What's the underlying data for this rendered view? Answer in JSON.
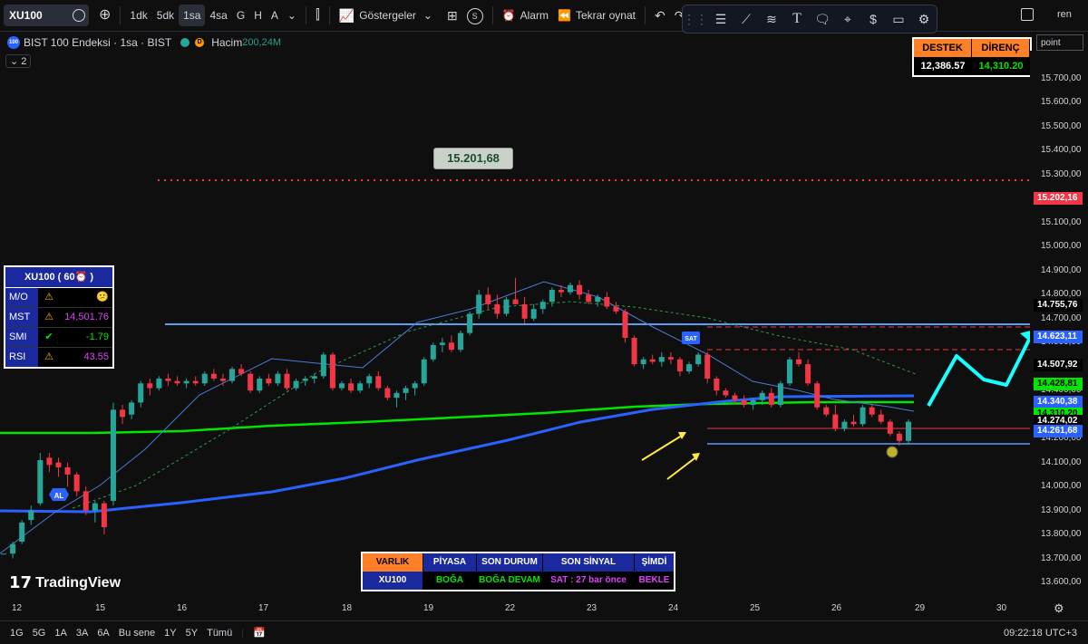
{
  "topbar": {
    "symbol": "XU100",
    "intervals": [
      "1dk",
      "5dk",
      "1sa",
      "4sa",
      "G",
      "H",
      "A"
    ],
    "active_interval": "1sa",
    "indicators_label": "Göstergeler",
    "alarm_label": "Alarm",
    "replay_label": "Tekrar oynat",
    "badge": "S",
    "user": "ren"
  },
  "legend": {
    "title": "BIST 100 Endeksi · 1sa · BIST",
    "badge_d": "D",
    "volume_label": "Hacim",
    "volume_value": "200,24M",
    "collapse": "2"
  },
  "support_resistance": {
    "support_label": "DESTEK",
    "resistance_label": "DİRENÇ",
    "support_value": "12,386.57",
    "resistance_value": "14,310.20"
  },
  "point_label": "point",
  "annotation": "15.201,68",
  "price_scale": {
    "labels": [
      "15.700,00",
      "15.600,00",
      "15.500,00",
      "15.400,00",
      "15.300,00",
      "15.200,00",
      "15.100,00",
      "15.000,00",
      "14.900,00",
      "14.800,00",
      "14.700,00",
      "14.600,00",
      "14.500,00",
      "14.400,00",
      "14.300,00",
      "14.200,00",
      "14.100,00",
      "14.000,00",
      "13.900,00",
      "13.800,00",
      "13.700,00",
      "13.600,00"
    ],
    "tags": [
      {
        "text": "15.202,16",
        "color": "#f23645",
        "bg": "#f23645",
        "fg": "#fff"
      },
      {
        "text": "14.755,76",
        "bg": "#000",
        "fg": "#fff"
      },
      {
        "text": "14.623,11",
        "bg": "#2962ff",
        "fg": "#fff"
      },
      {
        "text": "14.507,92",
        "bg": "#000",
        "fg": "#fff"
      },
      {
        "text": "14.428,81",
        "bg": "#00e600",
        "fg": "#000"
      },
      {
        "text": "14.340,38",
        "bg": "#2962ff",
        "fg": "#fff"
      },
      {
        "text": "14.310,20",
        "bg": "#00e600",
        "fg": "#000"
      },
      {
        "text": "14.274,02",
        "bg": "#000",
        "fg": "#fff"
      },
      {
        "text": "14.261,68",
        "bg": "#2962ff",
        "fg": "#fff"
      }
    ]
  },
  "info_panel": {
    "title": "XU100  ( 60⏰ )",
    "rows": [
      {
        "k": "M/O",
        "s": "⚠",
        "v": "😕"
      },
      {
        "k": "MST",
        "s": "⚠",
        "v": "14,501.76"
      },
      {
        "k": "SMI",
        "s": "✔",
        "v": "-1.79"
      },
      {
        "k": "RSI",
        "s": "⚠",
        "v": "43.55"
      }
    ]
  },
  "signal_labels": {
    "al": "AL",
    "sat": "SAT"
  },
  "bottom_table": {
    "headers": [
      "VARLIK",
      "PİYASA",
      "SON DURUM",
      "SON SİNYAL",
      "ŞİMDİ"
    ],
    "values": [
      "XU100",
      "BOĞA",
      "BOĞA DEVAM",
      "SAT : 27 bar önce",
      "BEKLE"
    ]
  },
  "watermark": "TradingView",
  "time_axis": [
    "12",
    "15",
    "16",
    "17",
    "18",
    "19",
    "22",
    "23",
    "24",
    "25",
    "26",
    "29",
    "30"
  ],
  "bottombar": {
    "ranges": [
      "1G",
      "5G",
      "1A",
      "3A",
      "6A",
      "Bu sene",
      "1Y",
      "5Y",
      "Tümü"
    ],
    "clock": "09:22:18 UTC+3"
  },
  "chart_data": {
    "type": "candlestick",
    "title": "BIST 100 Endeksi · 1sa · BIST",
    "ylim": [
      13570,
      15780
    ],
    "candles": [
      [
        13720,
        13720,
        13720,
        13720
      ],
      [
        13720,
        13770,
        13700,
        13760
      ],
      [
        13770,
        13860,
        13760,
        13850
      ],
      [
        13860,
        13920,
        13840,
        13900
      ],
      [
        13930,
        14140,
        13920,
        14110
      ],
      [
        14120,
        14140,
        14060,
        14090
      ],
      [
        14100,
        14120,
        14040,
        14080
      ],
      [
        14080,
        14100,
        14000,
        14050
      ],
      [
        14050,
        14060,
        13960,
        13980
      ],
      [
        13980,
        14000,
        13880,
        13900
      ],
      [
        13900,
        13940,
        13850,
        13930
      ],
      [
        13930,
        13940,
        13800,
        13830
      ],
      [
        13940,
        14350,
        13920,
        14320
      ],
      [
        14320,
        14340,
        14260,
        14290
      ],
      [
        14300,
        14360,
        14280,
        14350
      ],
      [
        14350,
        14440,
        14330,
        14430
      ],
      [
        14430,
        14450,
        14380,
        14410
      ],
      [
        14410,
        14460,
        14400,
        14450
      ],
      [
        14450,
        14470,
        14420,
        14440
      ],
      [
        14440,
        14460,
        14420,
        14430
      ],
      [
        14430,
        14450,
        14410,
        14440
      ],
      [
        14440,
        14460,
        14420,
        14430
      ],
      [
        14430,
        14480,
        14420,
        14470
      ],
      [
        14470,
        14490,
        14440,
        14450
      ],
      [
        14450,
        14470,
        14420,
        14440
      ],
      [
        14440,
        14500,
        14430,
        14490
      ],
      [
        14490,
        14510,
        14460,
        14470
      ],
      [
        14470,
        14480,
        14390,
        14400
      ],
      [
        14400,
        14460,
        14390,
        14450
      ],
      [
        14450,
        14470,
        14420,
        14430
      ],
      [
        14430,
        14480,
        14420,
        14470
      ],
      [
        14470,
        14490,
        14400,
        14410
      ],
      [
        14410,
        14450,
        14400,
        14440
      ],
      [
        14440,
        14460,
        14420,
        14450
      ],
      [
        14450,
        14470,
        14430,
        14460
      ],
      [
        14460,
        14560,
        14450,
        14550
      ],
      [
        14550,
        14560,
        14400,
        14410
      ],
      [
        14410,
        14440,
        14400,
        14430
      ],
      [
        14430,
        14450,
        14390,
        14400
      ],
      [
        14400,
        14440,
        14390,
        14430
      ],
      [
        14430,
        14470,
        14410,
        14460
      ],
      [
        14460,
        14480,
        14400,
        14410
      ],
      [
        14410,
        14420,
        14360,
        14370
      ],
      [
        14370,
        14400,
        14330,
        14390
      ],
      [
        14390,
        14420,
        14360,
        14410
      ],
      [
        14410,
        14440,
        14380,
        14430
      ],
      [
        14430,
        14540,
        14420,
        14530
      ],
      [
        14530,
        14600,
        14520,
        14590
      ],
      [
        14590,
        14620,
        14560,
        14600
      ],
      [
        14600,
        14630,
        14560,
        14570
      ],
      [
        14570,
        14650,
        14560,
        14640
      ],
      [
        14640,
        14730,
        14630,
        14720
      ],
      [
        14720,
        14820,
        14700,
        14800
      ],
      [
        14800,
        14830,
        14740,
        14760
      ],
      [
        14760,
        14800,
        14700,
        14720
      ],
      [
        14720,
        14790,
        14710,
        14780
      ],
      [
        14780,
        14870,
        14770,
        14760
      ],
      [
        14760,
        14790,
        14680,
        14700
      ],
      [
        14700,
        14760,
        14690,
        14740
      ],
      [
        14740,
        14780,
        14720,
        14770
      ],
      [
        14770,
        14830,
        14750,
        14820
      ],
      [
        14820,
        14840,
        14790,
        14810
      ],
      [
        14810,
        14850,
        14800,
        14840
      ],
      [
        14840,
        14860,
        14780,
        14800
      ],
      [
        14800,
        14820,
        14760,
        14770
      ],
      [
        14770,
        14800,
        14750,
        14790
      ],
      [
        14790,
        14810,
        14740,
        14750
      ],
      [
        14750,
        14770,
        14720,
        14730
      ],
      [
        14730,
        14740,
        14600,
        14620
      ],
      [
        14620,
        14630,
        14500,
        14510
      ],
      [
        14510,
        14540,
        14490,
        14530
      ],
      [
        14530,
        14550,
        14510,
        14520
      ],
      [
        14520,
        14560,
        14500,
        14540
      ],
      [
        14540,
        14560,
        14510,
        14530
      ],
      [
        14530,
        14540,
        14460,
        14480
      ],
      [
        14480,
        14520,
        14470,
        14510
      ],
      [
        14510,
        14560,
        14500,
        14550
      ],
      [
        14550,
        14560,
        14430,
        14450
      ],
      [
        14450,
        14460,
        14380,
        14400
      ],
      [
        14400,
        14410,
        14370,
        14380
      ],
      [
        14380,
        14390,
        14340,
        14360
      ],
      [
        14360,
        14380,
        14330,
        14340
      ],
      [
        14340,
        14370,
        14320,
        14360
      ],
      [
        14360,
        14400,
        14340,
        14390
      ],
      [
        14390,
        14410,
        14330,
        14340
      ],
      [
        14340,
        14440,
        14330,
        14430
      ],
      [
        14430,
        14540,
        14420,
        14530
      ],
      [
        14530,
        14560,
        14500,
        14510
      ],
      [
        14510,
        14530,
        14420,
        14430
      ],
      [
        14430,
        14440,
        14320,
        14330
      ],
      [
        14330,
        14340,
        14290,
        14300
      ],
      [
        14300,
        14340,
        14230,
        14240
      ],
      [
        14240,
        14280,
        14230,
        14270
      ],
      [
        14270,
        14300,
        14250,
        14260
      ],
      [
        14260,
        14340,
        14250,
        14330
      ],
      [
        14330,
        14340,
        14290,
        14300
      ],
      [
        14300,
        14320,
        14260,
        14270
      ],
      [
        14270,
        14280,
        14210,
        14220
      ],
      [
        14220,
        14230,
        14170,
        14190
      ],
      [
        14190,
        14280,
        14180,
        14270
      ]
    ]
  }
}
